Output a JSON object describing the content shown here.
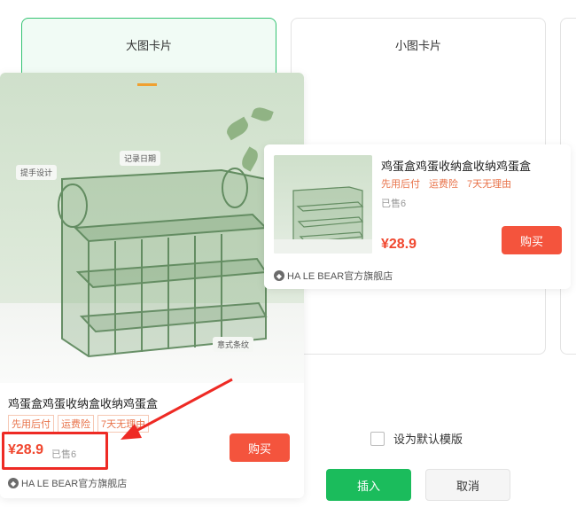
{
  "options": {
    "big_label": "大图卡片",
    "small_label": "小图卡片"
  },
  "product": {
    "title": "鸡蛋盒鸡蛋收纳盒收纳鸡蛋盒",
    "tags": [
      "先用后付",
      "运费险",
      "7天无理由"
    ],
    "price": "¥28.9",
    "sold": "已售6",
    "buy_label": "购买",
    "shop_name": "HA LE BEAR官方旗舰店",
    "image_callouts": [
      "提手设计",
      "记录日期",
      "意式条纹"
    ]
  },
  "footer": {
    "default_template_label": "设为默认模版",
    "insert_label": "插入",
    "cancel_label": "取消"
  },
  "colors": {
    "accent_green": "#1bbc5c",
    "price_red": "#f0462e",
    "buy_button": "#f4543d",
    "highlight_box": "#ee2a24"
  }
}
